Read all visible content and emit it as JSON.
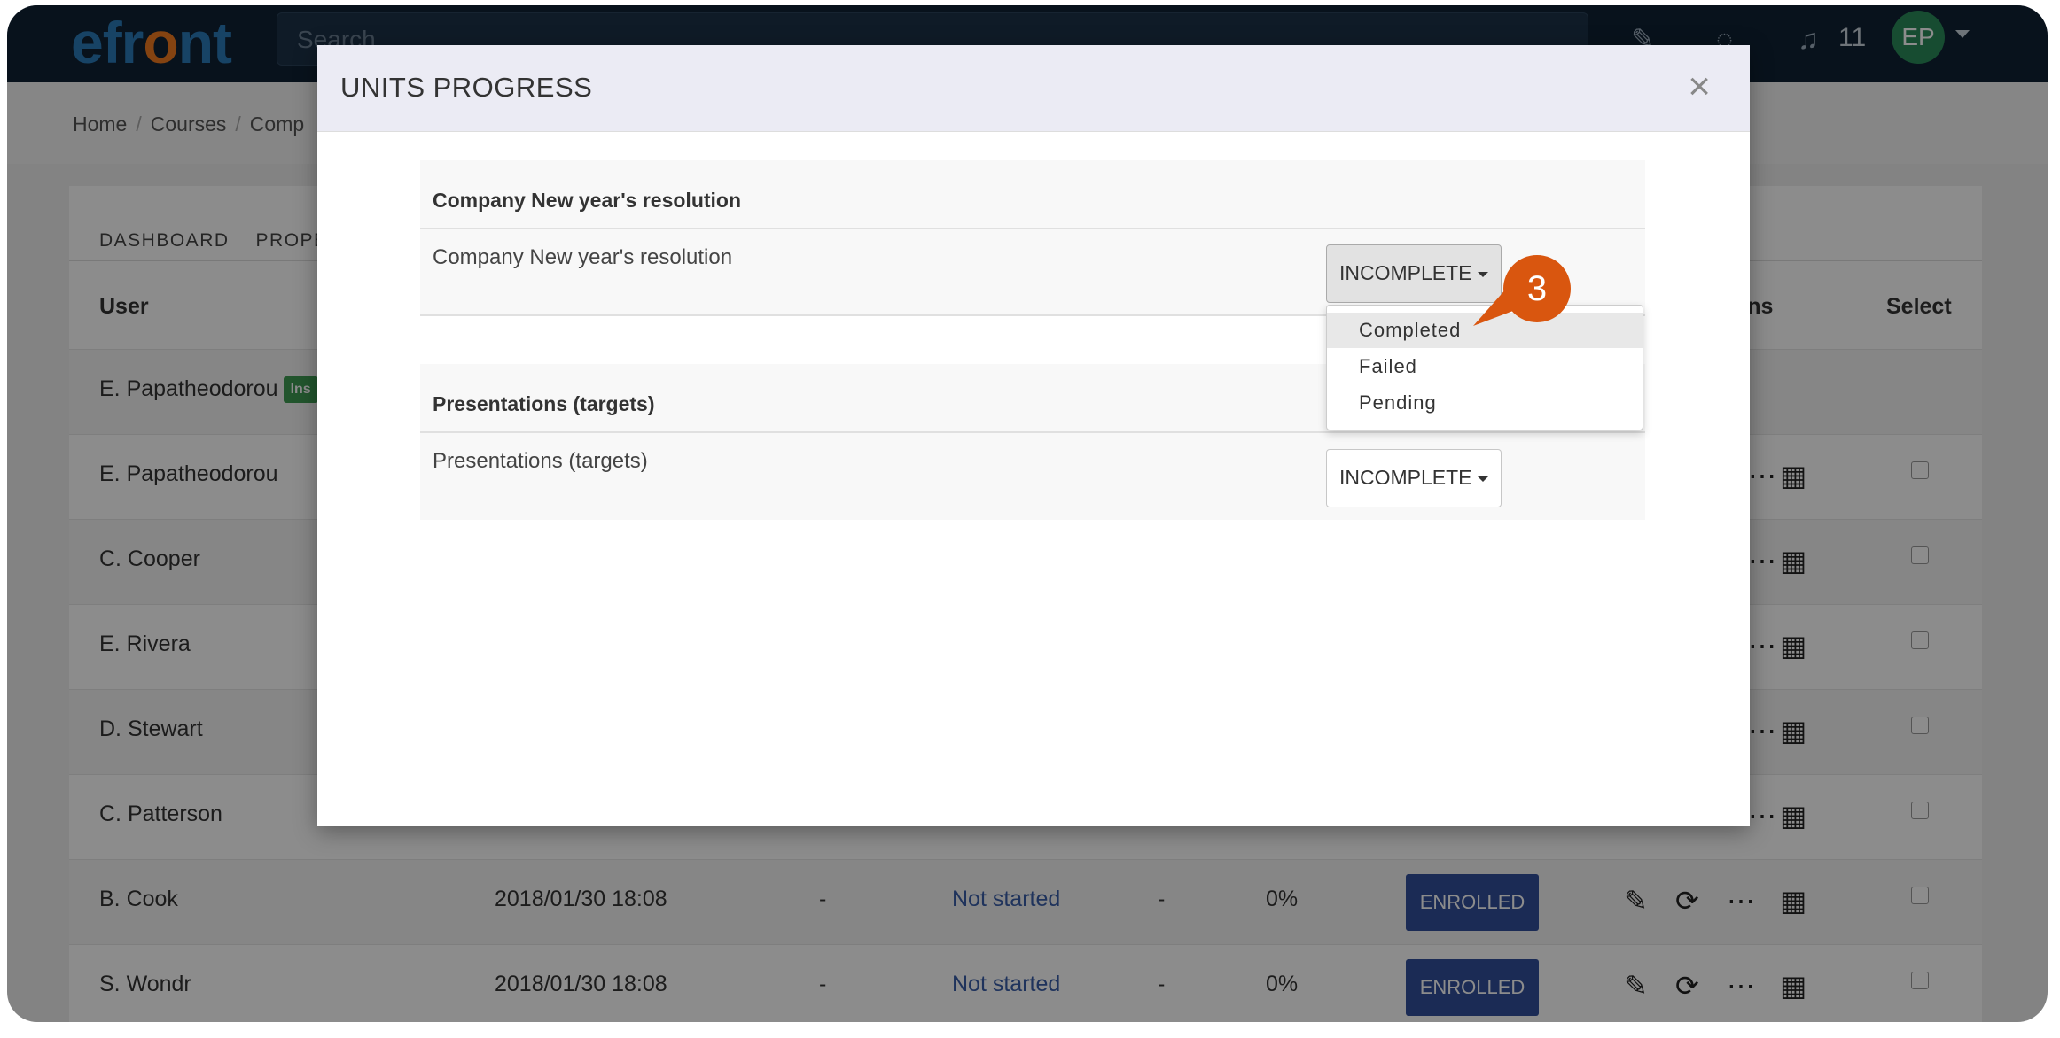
{
  "navbar": {
    "logo_part1": "efr",
    "logo_part2": "o",
    "logo_part3": "nt",
    "search_placeholder": "Search",
    "notification_count": "11",
    "avatar_initials": "EP"
  },
  "breadcrumb": {
    "items": [
      "Home",
      "Courses",
      "Comp"
    ]
  },
  "page": {
    "tabs": [
      "DASHBOARD",
      "PROPE"
    ],
    "columns": {
      "user": "User",
      "actions": "ons",
      "select": "Select"
    },
    "rows": [
      {
        "user": "E. Papatheodorou",
        "badge": "Ins"
      },
      {
        "user": "E. Papatheodorou"
      },
      {
        "user": "C. Cooper"
      },
      {
        "user": "E. Rivera"
      },
      {
        "user": "D. Stewart"
      },
      {
        "user": "C. Patterson"
      },
      {
        "user": "B. Cook",
        "date": "2018/01/30 18:08",
        "dash1": "-",
        "status": "Not started",
        "dash2": "-",
        "progress": "0%",
        "enrollment": "ENROLLED"
      },
      {
        "user": "S. Wondr",
        "date": "2018/01/30 18:08",
        "dash1": "-",
        "status": "Not started",
        "dash2": "-",
        "progress": "0%",
        "enrollment": "ENROLLED"
      }
    ]
  },
  "modal": {
    "title": "UNITS PROGRESS",
    "close_glyph": "×",
    "units": [
      {
        "heading": "Company New year's resolution",
        "name": "Company New year's resolution",
        "status": "INCOMPLETE"
      },
      {
        "heading": "Presentations (targets)",
        "name": "Presentations (targets)",
        "status": "INCOMPLETE"
      }
    ],
    "dropdown_options": [
      "Completed",
      "Failed",
      "Pending"
    ]
  },
  "callout": {
    "step": "3",
    "color": "#d9560f"
  },
  "colors": {
    "navbar": "#0f2133",
    "enrolled_badge": "#324f9b",
    "instructor_badge": "#3f9b52",
    "link": "#3a5ea8"
  },
  "icons": [
    "graduation-cap-icon",
    "chat-icon",
    "bell-icon",
    "pencil-icon",
    "refresh-icon",
    "ellipsis-icon",
    "calendar-icon",
    "close-icon",
    "caret-down-icon"
  ]
}
